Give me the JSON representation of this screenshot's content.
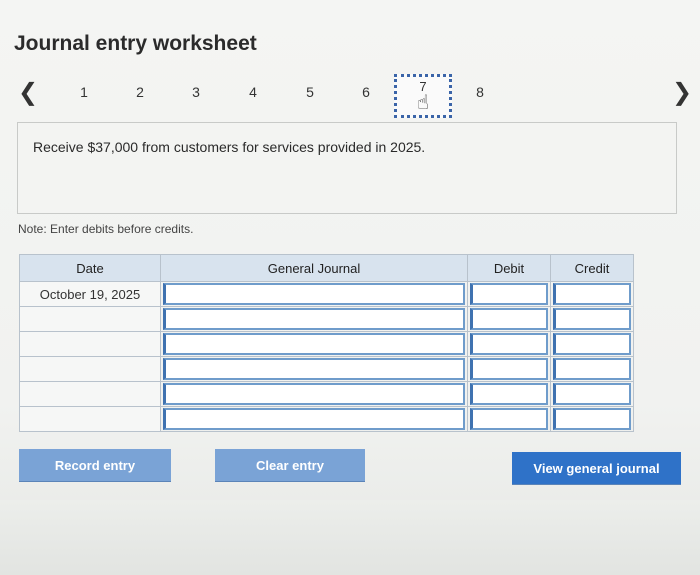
{
  "worksheet": {
    "title": "Journal entry worksheet",
    "nav": {
      "prev_icon": "chevron-left-icon",
      "next_icon": "chevron-right-icon",
      "steps": [
        "1",
        "2",
        "3",
        "4",
        "5",
        "6",
        "7",
        "8"
      ],
      "active_step": "7"
    },
    "description": "Receive $37,000 from customers for services provided in 2025.",
    "note": "Note: Enter debits before credits.",
    "table": {
      "headers": {
        "date": "Date",
        "journal": "General Journal",
        "debit": "Debit",
        "credit": "Credit"
      },
      "rows": [
        {
          "date": "October 19, 2025",
          "account": "",
          "debit": "",
          "credit": ""
        },
        {
          "date": "",
          "account": "",
          "debit": "",
          "credit": ""
        },
        {
          "date": "",
          "account": "",
          "debit": "",
          "credit": ""
        },
        {
          "date": "",
          "account": "",
          "debit": "",
          "credit": ""
        },
        {
          "date": "",
          "account": "",
          "debit": "",
          "credit": ""
        },
        {
          "date": "",
          "account": "",
          "debit": "",
          "credit": ""
        }
      ]
    },
    "buttons": {
      "record": "Record entry",
      "clear": "Clear entry",
      "view": "View general journal"
    }
  }
}
